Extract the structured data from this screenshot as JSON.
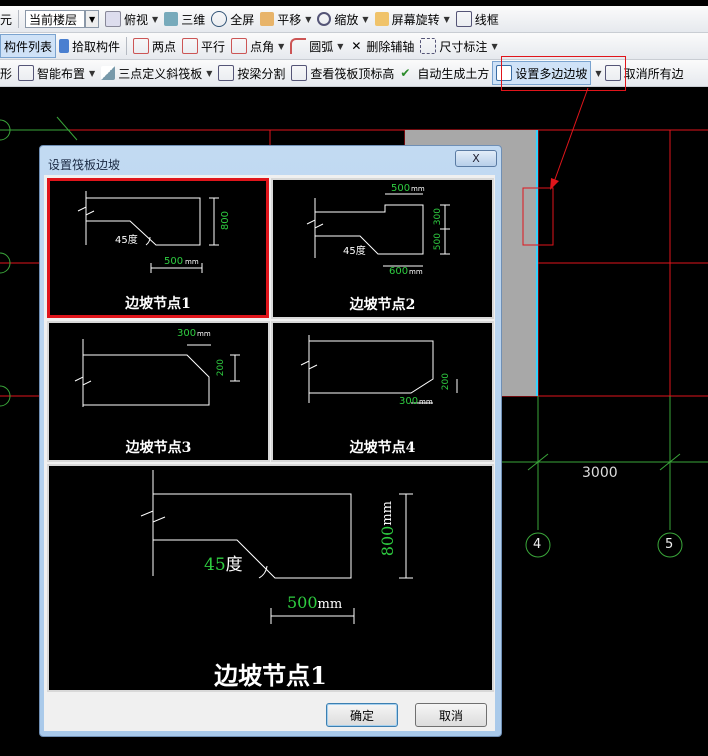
{
  "toolbar1": {
    "partial_left": "元",
    "floor_combo": "当前楼层",
    "view_top": "俯视",
    "view_3d": "三维",
    "fullscreen": "全屏",
    "pan": "平移",
    "zoom": "缩放",
    "rotate": "屏幕旋转",
    "wireframe": "线框"
  },
  "toolbar2": {
    "component_list": "构件列表",
    "pick_component": "拾取构件",
    "two_points": "两点",
    "parallel": "平行",
    "point_angle": "点角",
    "arc": "圆弧",
    "delete_axis": "删除辅轴",
    "dimension": "尺寸标注"
  },
  "toolbar3": {
    "partial_left": "矩形",
    "smart_layout": "智能布置",
    "three_point_slope": "三点定义斜筏板",
    "split_by_beam": "按梁分割",
    "view_top_elev": "查看筏板顶标高",
    "auto_earthwork": "自动生成土方",
    "set_multi_edge_slope": "设置多边边坡",
    "cancel_all": "取消所有边"
  },
  "canvas": {
    "dimension_value": "3000",
    "axis_4": "4",
    "axis_5": "5"
  },
  "dialog": {
    "title": "设置筏板边坡",
    "close": "X",
    "ok": "确定",
    "cancel": "取消",
    "selected_option": "边坡节点1",
    "options": [
      {
        "label": "边坡节点1",
        "dims": {
          "angle": "45度",
          "width": "500",
          "width_unit": "mm",
          "height": "800",
          "height_unit": "mm"
        }
      },
      {
        "label": "边坡节点2",
        "dims": {
          "top": "500",
          "top_unit": "mm",
          "angle": "45度",
          "bottom": "600",
          "bottom_unit": "mm",
          "h1": "300",
          "h1_unit": "mm",
          "h2": "500",
          "h2_unit": "mm"
        }
      },
      {
        "label": "边坡节点3",
        "dims": {
          "width": "300",
          "width_unit": "mm",
          "height": "200",
          "height_unit": "mm"
        }
      },
      {
        "label": "边坡节点4",
        "dims": {
          "width": "300",
          "width_unit": "mm",
          "height": "200",
          "height_unit": "mm"
        }
      }
    ],
    "preview": {
      "label": "边坡节点1",
      "angle": "45",
      "angle_unit": "度",
      "width": "500",
      "width_unit": "mm",
      "height": "800",
      "height_unit": "mm"
    }
  },
  "colors": {
    "accent_red": "#e0151b",
    "grid_green": "#3aa63a",
    "dim_green": "#2ecc40",
    "grey_fill": "#a8a8a8",
    "dialog_blue": "#b8d3ee"
  }
}
